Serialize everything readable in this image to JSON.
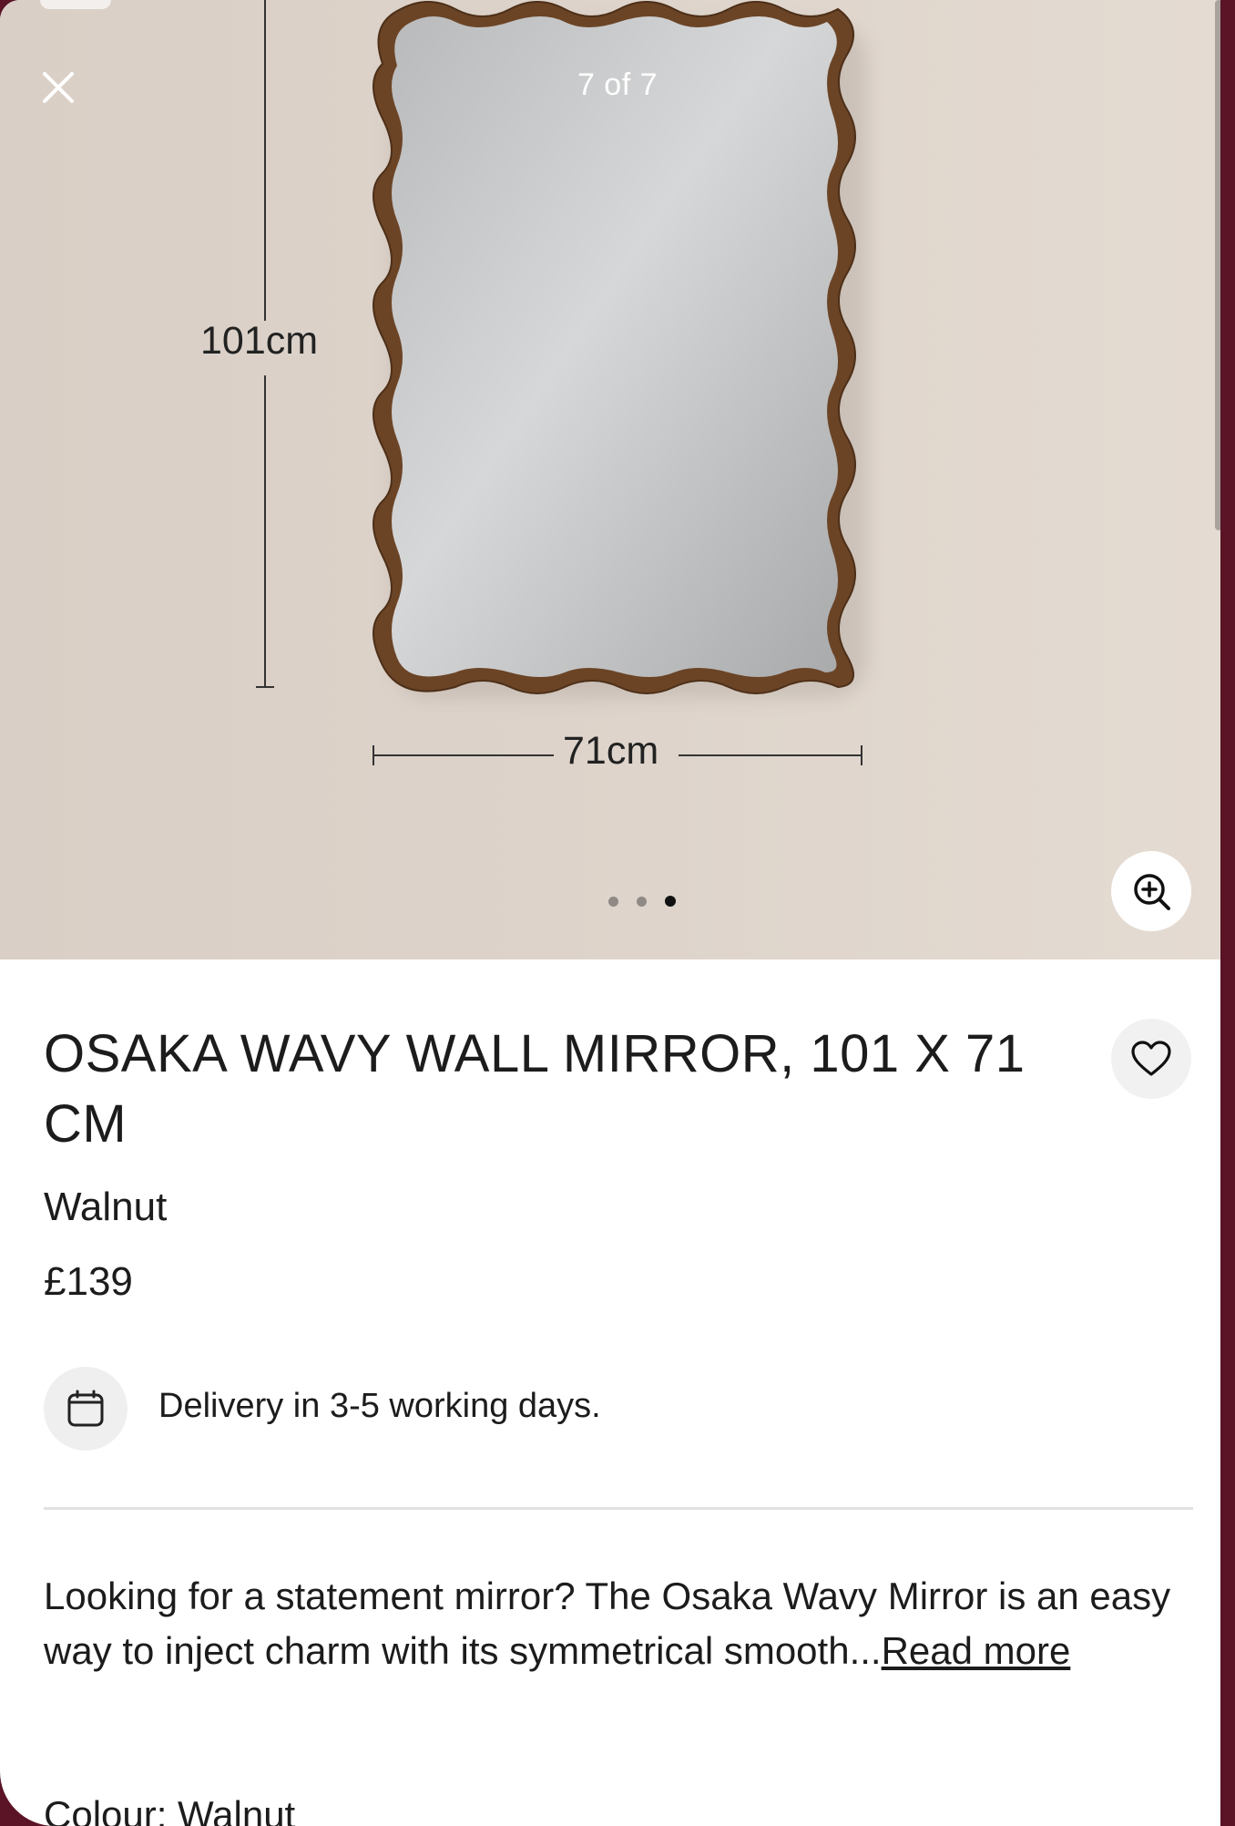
{
  "gallery": {
    "counter": "7 of 7",
    "height_label": "101cm",
    "width_label": "71cm",
    "dots_total": 3,
    "dots_active_index": 2
  },
  "icons": {
    "close": "close-icon",
    "zoom": "zoom-in-icon",
    "favourite": "heart-icon",
    "delivery": "calendar-icon"
  },
  "product": {
    "title": "OSAKA WAVY WALL MIRROR, 101 X 71 CM",
    "colour": "Walnut",
    "price": "£139",
    "delivery": "Delivery in 3-5 working days.",
    "description": "Looking for a statement mirror? The Osaka Wavy Mirror is an easy way to inject charm with its symmetrical smooth...",
    "read_more": "Read more",
    "colour_line": "Colour: Walnut"
  },
  "colors": {
    "frame": "#6b4426",
    "background_border": "#5a1426"
  }
}
